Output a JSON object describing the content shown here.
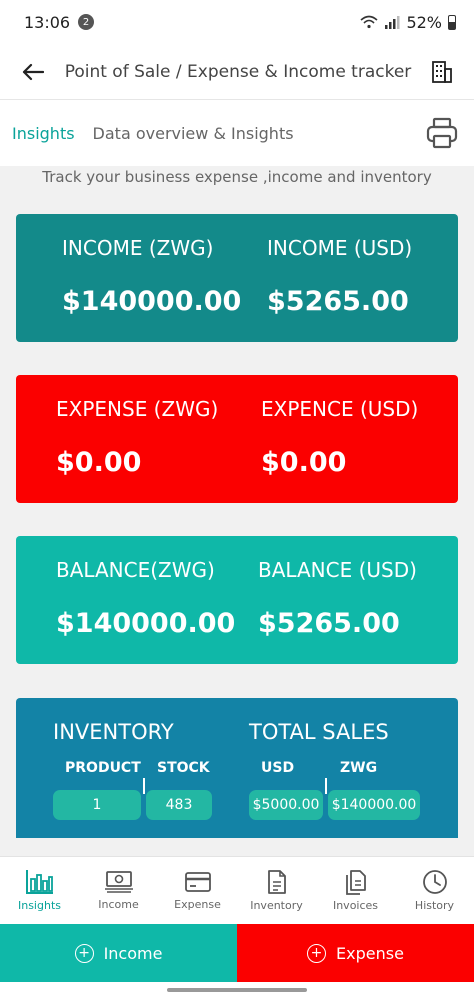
{
  "status": {
    "time": "13:06",
    "notifications": "2",
    "battery": "52%"
  },
  "appbar": {
    "title": "Point of Sale / Expense & Income tracker"
  },
  "subheader": {
    "active_tab": "Insights",
    "description": "Data overview & Insights"
  },
  "tagline": "Track your business expense ,income and inventory",
  "colors": {
    "accent": "#0aa39a",
    "income_card": "#138a8a",
    "expense_card": "#fb0000",
    "balance_card": "#0fb8a8",
    "inventory_card": "#1383a6"
  },
  "income": {
    "zwg_label": "INCOME (ZWG)",
    "zwg_value": "$140000.00",
    "usd_label": "INCOME (USD)",
    "usd_value": "$5265.00"
  },
  "expense": {
    "zwg_label": "EXPENSE (ZWG)",
    "zwg_value": "$0.00",
    "usd_label": "EXPENCE (USD)",
    "usd_value": "$0.00"
  },
  "balance": {
    "zwg_label": "BALANCE(ZWG)",
    "zwg_value": "$140000.00",
    "usd_label": "BALANCE (USD)",
    "usd_value": "$5265.00"
  },
  "inventory": {
    "title": "INVENTORY",
    "product_label": "PRODUCT",
    "product_value": "1",
    "stock_label": "STOCK",
    "stock_value": "483"
  },
  "sales": {
    "title": "TOTAL SALES",
    "usd_label": "USD",
    "usd_value": "$5000.00",
    "zwg_label": "ZWG",
    "zwg_value": "$140000.00"
  },
  "nav": [
    {
      "label": "Insights",
      "icon": "bar-chart-icon"
    },
    {
      "label": "Income",
      "icon": "cash-icon"
    },
    {
      "label": "Expense",
      "icon": "card-icon"
    },
    {
      "label": "Inventory",
      "icon": "document-icon"
    },
    {
      "label": "Invoices",
      "icon": "invoices-icon"
    },
    {
      "label": "History",
      "icon": "history-icon"
    }
  ],
  "actions": {
    "income_label": "Income",
    "expense_label": "Expense"
  }
}
